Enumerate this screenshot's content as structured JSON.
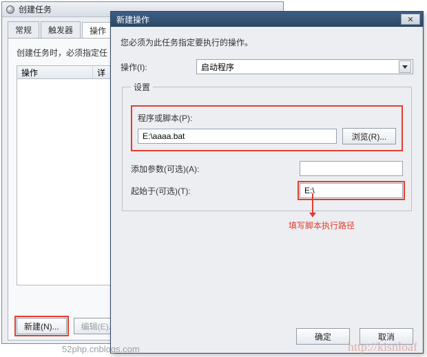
{
  "back_window": {
    "title": "创建任务",
    "tabs": [
      "常规",
      "触发器",
      "操作"
    ],
    "active_tab_index": 2,
    "panel_desc": "创建任务时，必须指定任",
    "list_headers": {
      "col1": "操作",
      "col2": "详"
    },
    "buttons": {
      "new": "新建(N)...",
      "edit": "编辑(E)..."
    }
  },
  "dialog": {
    "title": "新建操作",
    "close_glyph": "✕",
    "instruction": "您必须为此任务指定要执行的操作。",
    "action_label": "操作(I):",
    "action_value": "启动程序",
    "group_legend": "设置",
    "program": {
      "label": "程序或脚本(P):",
      "value": "E:\\aaaa.bat",
      "browse": "浏览(R)..."
    },
    "args": {
      "label": "添加参数(可选)(A):",
      "value": ""
    },
    "startin": {
      "label": "起始于(可选)(T):",
      "value": "E:\\"
    },
    "annotation": "填写脚本执行路径",
    "buttons": {
      "ok": "确定",
      "cancel": "取消"
    }
  },
  "watermark_left": "52php.cnblogs.com",
  "watermark_right": "http://kisnloaf"
}
